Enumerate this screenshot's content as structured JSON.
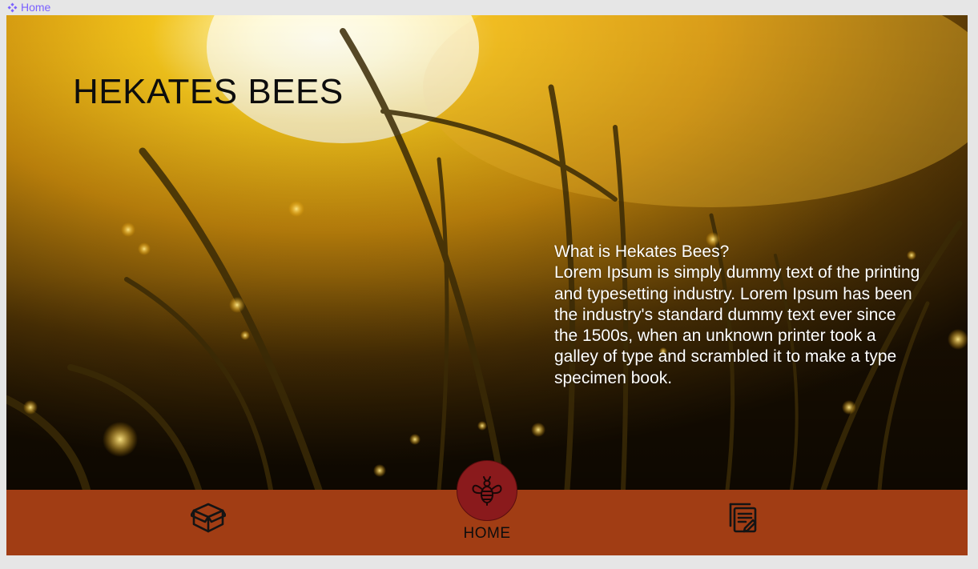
{
  "breadcrumb": {
    "label": "Home",
    "icon": "component-icon",
    "color": "#7b61ff"
  },
  "hero": {
    "title": "HEKATES BEES",
    "about_heading": "What is Hekates Bees?",
    "about_body": "Lorem Ipsum is simply dummy text of the printing and typesetting industry. Lorem Ipsum has been the industry's standard dummy text ever since the 1500s, when an unknown printer took a galley of type and scrambled it to make a type specimen book."
  },
  "navbar": {
    "background": "#a13d14",
    "left_icon": "package-icon",
    "center_icon": "bee-icon",
    "center_label": "HOME",
    "center_color": "#8a1a1c",
    "right_icon": "notes-icon"
  }
}
